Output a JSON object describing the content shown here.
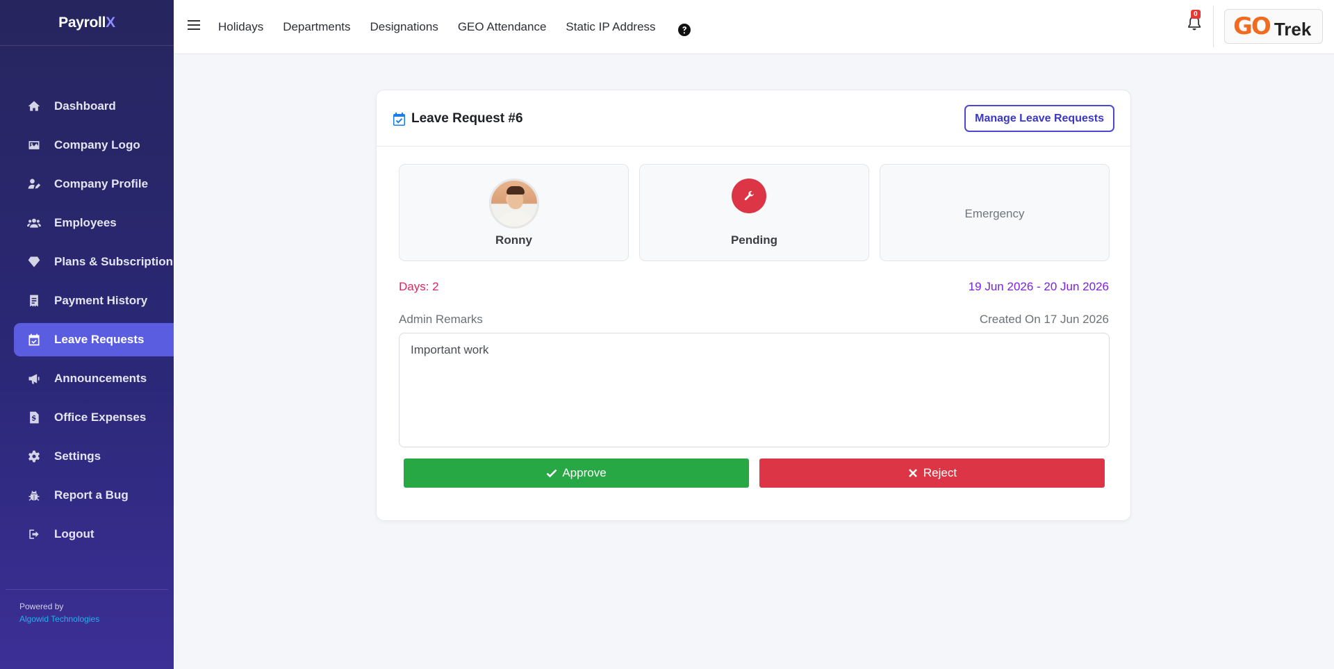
{
  "brand": {
    "name_part1": "Payroll",
    "name_part2": "X"
  },
  "sidebar": {
    "items": [
      {
        "label": "Dashboard",
        "icon": "home-icon"
      },
      {
        "label": "Company Logo",
        "icon": "image-icon"
      },
      {
        "label": "Company Profile",
        "icon": "user-edit-icon"
      },
      {
        "label": "Employees",
        "icon": "users-icon"
      },
      {
        "label": "Plans & Subscription",
        "icon": "gem-icon"
      },
      {
        "label": "Payment History",
        "icon": "receipt-icon"
      },
      {
        "label": "Leave Requests",
        "icon": "calendar-check-icon",
        "active": true
      },
      {
        "label": "Announcements",
        "icon": "bullhorn-icon"
      },
      {
        "label": "Office Expenses",
        "icon": "file-invoice-dollar-icon"
      },
      {
        "label": "Settings",
        "icon": "gear-icon"
      },
      {
        "label": "Report a Bug",
        "icon": "bug-icon"
      },
      {
        "label": "Logout",
        "icon": "sign-out-icon"
      }
    ],
    "footer": {
      "powered_by": "Powered by",
      "company": "Algowid Technologies"
    }
  },
  "topbar": {
    "links": [
      "Holidays",
      "Departments",
      "Designations",
      "GEO Attendance",
      "Static IP Address"
    ],
    "notification_count": "0",
    "logo_text": {
      "go": "GO",
      "trek": "Trek"
    }
  },
  "card": {
    "title": "Leave Request #6",
    "manage_button": "Manage Leave Requests",
    "employee_name": "Ronny",
    "status": "Pending",
    "leave_type": "Emergency",
    "days": "Days: 2",
    "date_range": "19 Jun 2026 - 20 Jun 2026",
    "remarks_label": "Admin Remarks",
    "created_on": "Created On 17 Jun 2026",
    "remarks_value": "Important work",
    "approve_label": "Approve",
    "reject_label": "Reject"
  },
  "colors": {
    "accent": "#5a5de0",
    "approve": "#28a745",
    "reject": "#dc3545",
    "status_pending": "#dc3545",
    "date_range": "#7a1fe0",
    "days": "#e0245e"
  }
}
